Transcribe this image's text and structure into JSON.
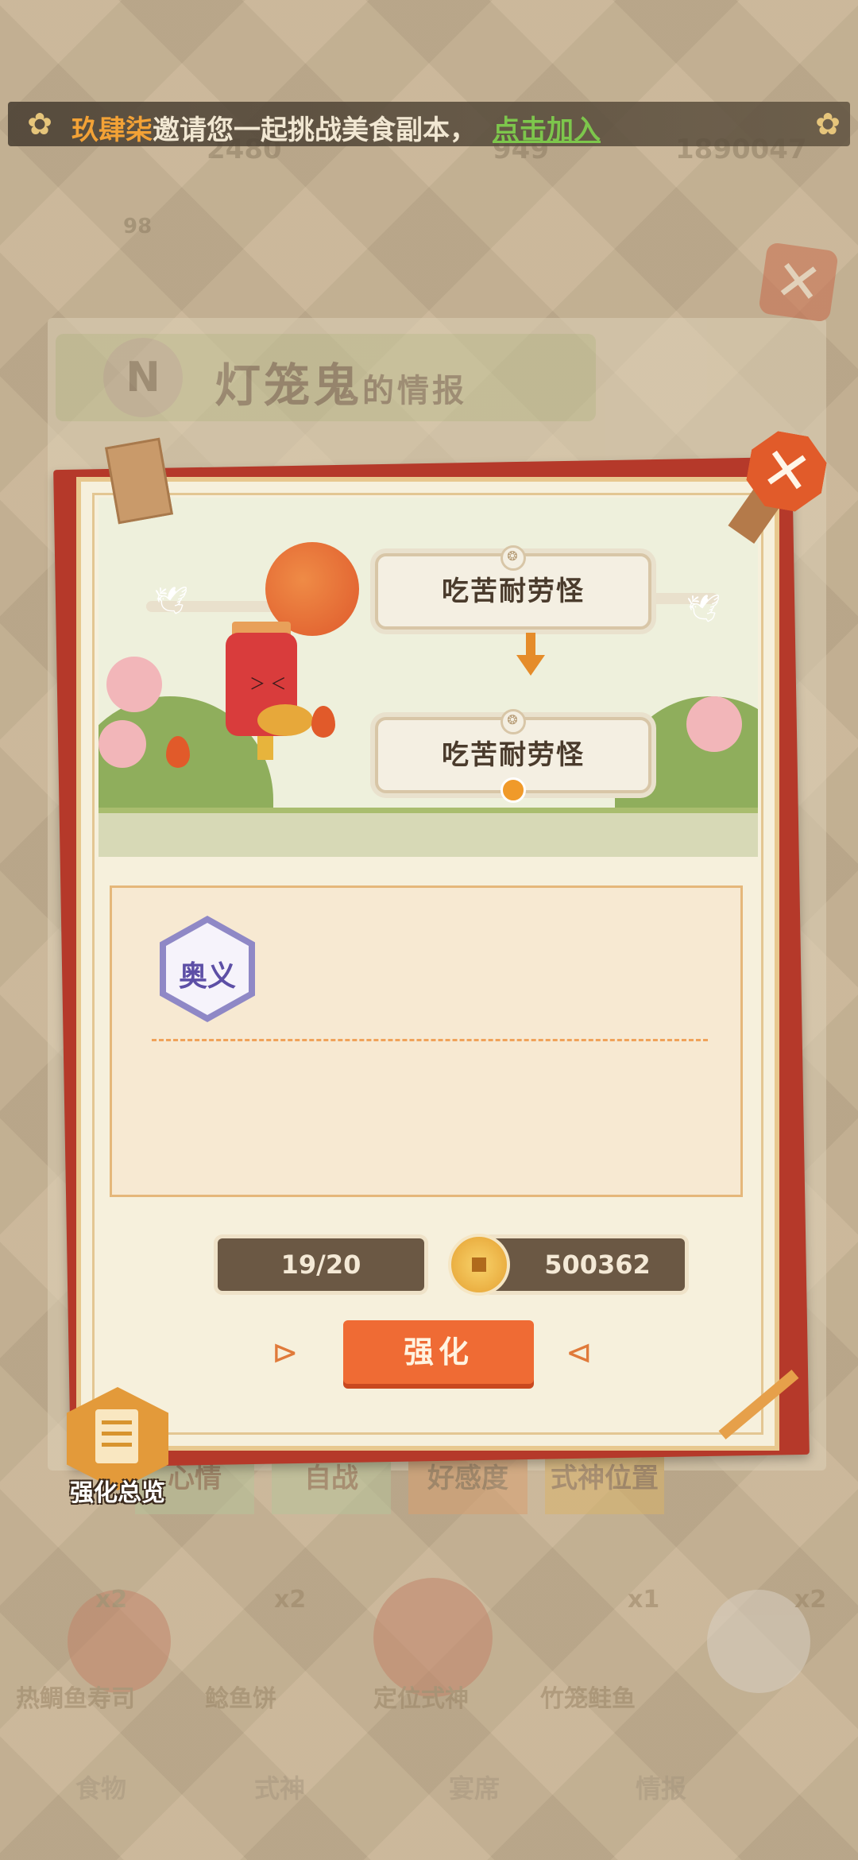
{
  "invite": {
    "inviter": "玖肆柒",
    "message": "邀请您一起挑战美食副本，",
    "join_link": "点击加入"
  },
  "background": {
    "stats": [
      "2480",
      "949",
      "1890047"
    ],
    "level": "98",
    "title_name": "灯笼鬼",
    "title_suffix": "的情报",
    "badge_letter": "N",
    "tabs": [
      "心情",
      "自战",
      "好感度",
      "式神位置"
    ],
    "characters": [
      {
        "label": "热鲷鱼寿司",
        "count": "x2"
      },
      {
        "label": "鲶鱼饼",
        "count": "x2"
      },
      {
        "label": "定位式神",
        "count": ""
      },
      {
        "label": "竹笼鲑鱼",
        "count": "x1"
      },
      {
        "label": "",
        "count": "x2"
      }
    ],
    "bottom_nav": [
      "食物",
      "式神",
      "宴席",
      "情报"
    ]
  },
  "card": {
    "current_trait": "吃苦耐劳怪",
    "next_trait": "吃苦耐劳怪",
    "badge_label": "奥义",
    "progress_text": "19/20",
    "coins": "500362",
    "enhance_label": "强化"
  },
  "overview_label": "强化总览",
  "colors": {
    "accent_orange": "#ef6b34",
    "card_red": "#b5392a",
    "link_green": "#7dc64c",
    "inviter_orange": "#f3a236",
    "badge_purple": "#8f88c6"
  },
  "icons": [
    "close-icon",
    "coin-icon",
    "sakura-icon",
    "overview-document-icon",
    "arrow-down-icon",
    "location-pin-icon"
  ]
}
